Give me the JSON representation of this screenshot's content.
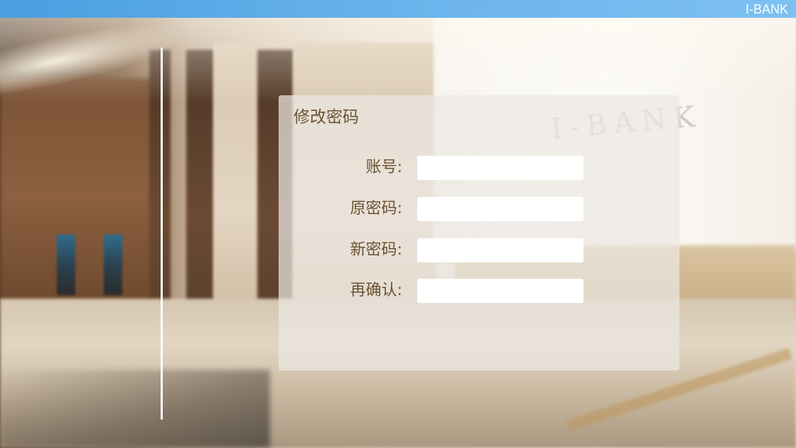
{
  "header": {
    "brand": "I-BANK",
    "accent_color": "#5aaae8"
  },
  "background": {
    "wall_logo": "I-BANK"
  },
  "form": {
    "title": "修改密码",
    "fields": [
      {
        "label": "账号:",
        "value": "",
        "placeholder": ""
      },
      {
        "label": "原密码:",
        "value": "",
        "placeholder": ""
      },
      {
        "label": "新密码:",
        "value": "",
        "placeholder": ""
      },
      {
        "label": "再确认:",
        "value": "",
        "placeholder": ""
      }
    ],
    "label_color": "#6a5333"
  }
}
